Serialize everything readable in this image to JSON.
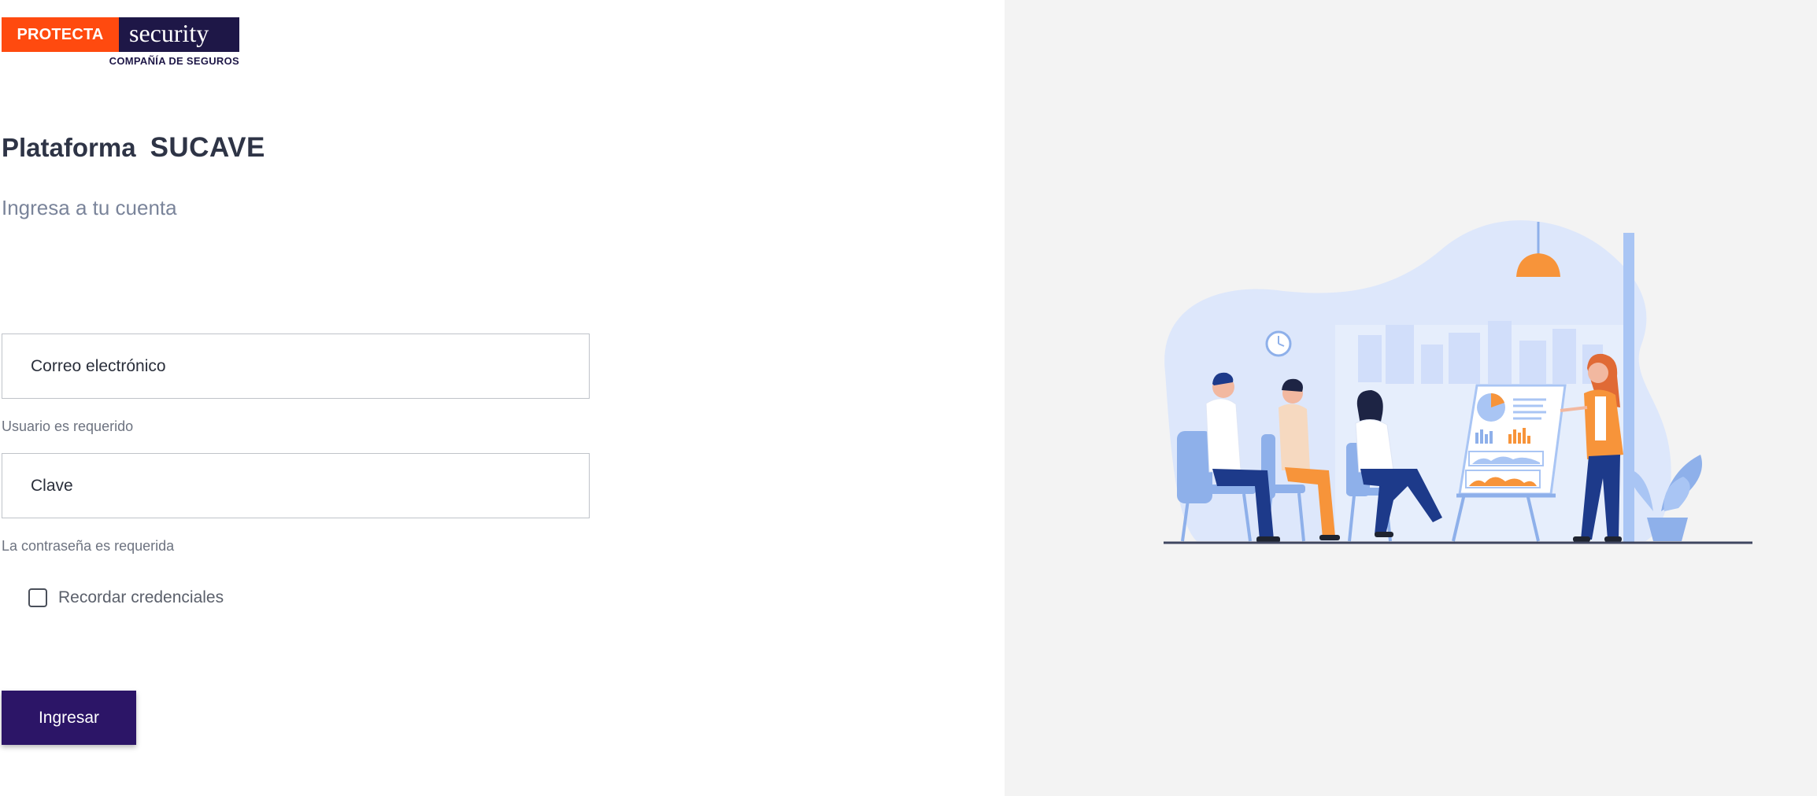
{
  "logo": {
    "left_text": "PROTECTA",
    "right_text": "security",
    "subtitle": "COMPAÑÍA DE SEGUROS"
  },
  "header": {
    "title": "Plataforma",
    "brand": "SUCAVE",
    "subtitle": "Ingresa a tu cuenta"
  },
  "form": {
    "email_placeholder": "Correo electrónico",
    "email_value": "",
    "email_helper": "Usuario es requerido",
    "password_placeholder": "Clave",
    "password_value": "",
    "password_helper": "La contraseña es requerida",
    "remember_label": "Recordar credenciales",
    "remember_checked": false,
    "submit_label": "Ingresar"
  },
  "illustration": {
    "icon": "team-presentation-illustration"
  },
  "colors": {
    "brand_red": "#ff4a0f",
    "brand_navy": "#1e1747",
    "button": "#2c1567",
    "right_background": "#f3f3f3",
    "illustration_blue": "#8eb0ea",
    "illustration_orange": "#f7943a"
  }
}
